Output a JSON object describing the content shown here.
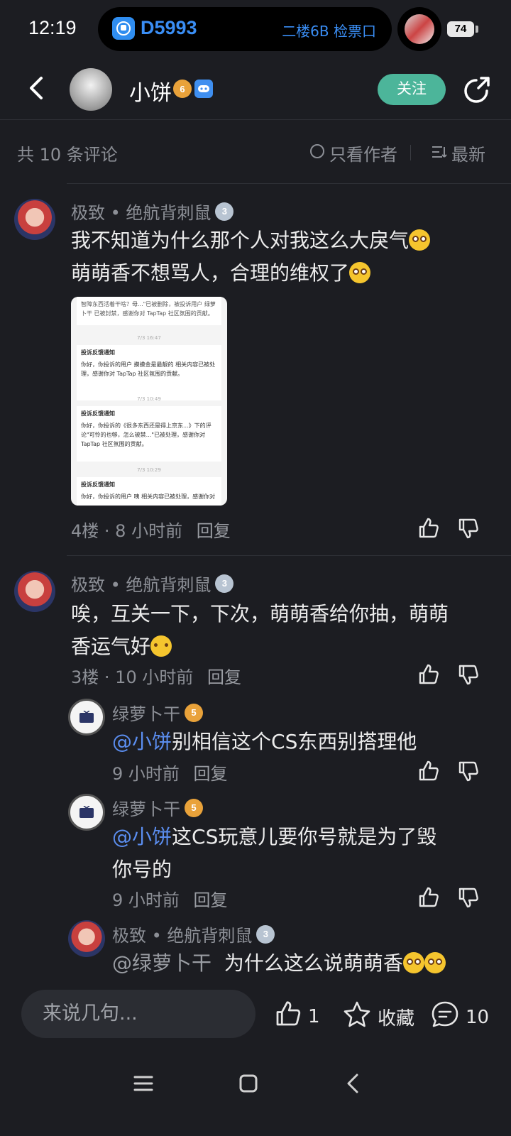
{
  "status_bar": {
    "time": "12:19",
    "train_number": "D5993",
    "station_info": "二楼6B 检票口",
    "battery": "74"
  },
  "header": {
    "username": "小饼",
    "level_badge": "6",
    "follow_label": "关注"
  },
  "sort_bar": {
    "comment_count": "共 10 条评论",
    "only_author": "只看作者",
    "sort_latest": "最新"
  },
  "comments": [
    {
      "author": "极致 • 绝航背刺鼠",
      "level": "3",
      "lines": [
        "我不知道为什么那个人对我这么大戾气",
        "萌萌香不想骂人，合理的维权了"
      ],
      "floor": "4楼",
      "time": "8 小时前",
      "reply_label": "回复",
      "screenshot": {
        "top_text": "智障东西活着干啥？母...\"已被删除，被投诉用户 绿萝卜干 已被封禁，感谢你对 TapTap 社区氛围的贡献。",
        "cards": [
          {
            "stamp": "7/3 16:47",
            "title": "投诉反馈通知",
            "text": "你好，你投诉的用户 摸摸金是最靓的 相关内容已被处理，感谢你对 TapTap 社区氛围的贡献。"
          },
          {
            "stamp": "7/3 10:49",
            "title": "投诉反馈通知",
            "text": "你好，你投诉的《很多东西还是得上京东...》下的评论\"可怜的也够，怎么被禁...\"已被处理，感谢你对 TapTap 社区氛围的贡献。"
          },
          {
            "stamp": "7/3 10:29",
            "title": "投诉反馈通知",
            "text": "你好，你投诉的用户 咦 相关内容已被处理，感谢你对"
          }
        ]
      }
    },
    {
      "author": "极致 • 绝航背刺鼠",
      "level": "3",
      "lines": [
        "唉，互关一下，下次，萌萌香给你抽，萌萌",
        "香运气好"
      ],
      "floor": "3楼",
      "time": "10 小时前",
      "reply_label": "回复",
      "replies": [
        {
          "author": "绿萝卜干",
          "level": "5",
          "mention": "@小饼",
          "lines": [
            "别相信这个CS东西别搭理他"
          ],
          "time": "9 小时前",
          "reply_label": "回复"
        },
        {
          "author": "绿萝卜干",
          "level": "5",
          "mention": "@小饼",
          "lines": [
            "这CS玩意儿要你号就是为了毁",
            "你号的"
          ],
          "time": "9 小时前",
          "reply_label": "回复"
        },
        {
          "author": "极致 • 绝航背刺鼠",
          "level": "3",
          "mention": "@绿萝卜干",
          "lines": [
            "为什么这么说萌萌香"
          ]
        }
      ]
    }
  ],
  "bottom_bar": {
    "input_placeholder": "来说几句...",
    "like_count": "1",
    "favorite_label": "收藏",
    "comment_count": "10"
  },
  "colors": {
    "accent_follow": "#4cb59a",
    "mention": "#5b8ef0",
    "background": "#1c1d22"
  }
}
